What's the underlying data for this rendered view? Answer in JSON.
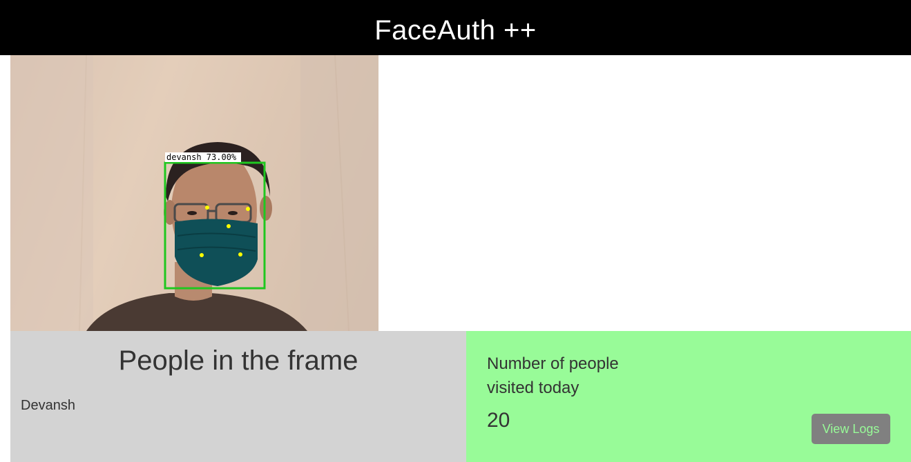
{
  "header": {
    "title": "FaceAuth ++"
  },
  "camera": {
    "detection_label": "devansh 73.00%",
    "box_color": "#1fc71f",
    "landmark_color": "#ffff00"
  },
  "people_panel": {
    "title": "People in the frame",
    "people": [
      "Devansh"
    ],
    "background": "#d3d3d3"
  },
  "stats_panel": {
    "label": "Number of people visited today",
    "count": "20",
    "button_label": "View Logs",
    "background": "#98fb98"
  }
}
